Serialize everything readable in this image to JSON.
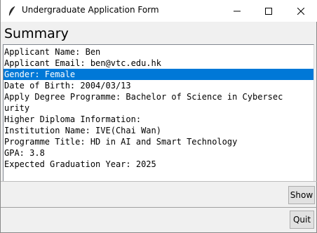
{
  "window": {
    "title": "Undergraduate Application Form",
    "icon": "feather-icon"
  },
  "heading": "Summary",
  "summary_lines": [
    "Applicant Name: Ben",
    "Applicant Email: ben@vtc.edu.hk",
    "Gender: Female",
    "Date of Birth: 2004/03/13",
    "Apply Degree Programme: Bachelor of Science in Cybersec",
    "urity",
    "Higher Diploma Information:",
    "Institution Name: IVE(Chai Wan)",
    "Programme Title: HD in AI and Smart Technology",
    "GPA: 3.8",
    "Expected Graduation Year: 2025"
  ],
  "buttons": {
    "show": "Show",
    "quit": "Quit"
  },
  "colors": {
    "selection": "#0078d7"
  }
}
